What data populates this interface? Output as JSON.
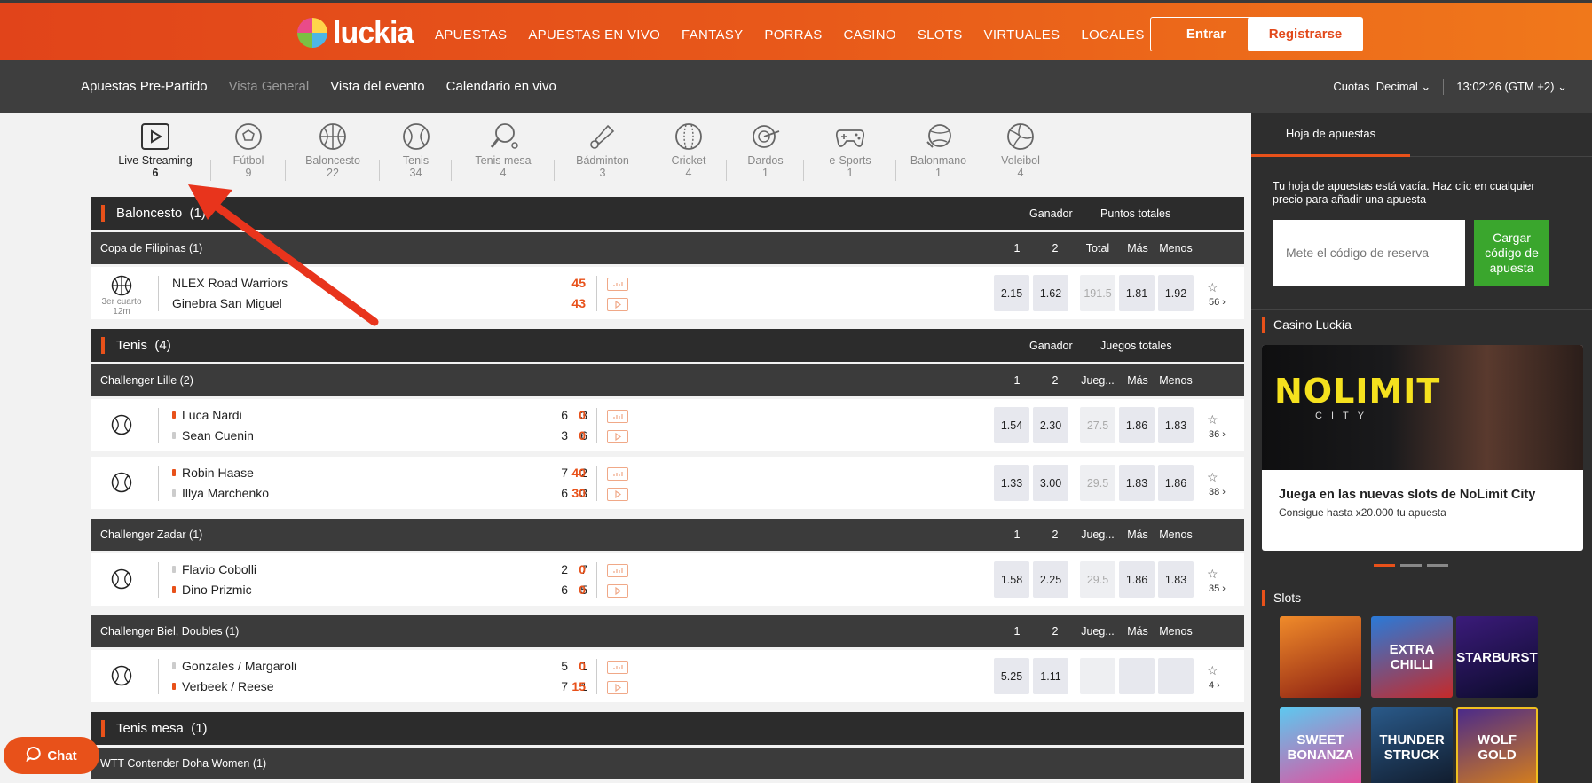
{
  "header": {
    "logo_text": "luckia",
    "nav": [
      "APUESTAS",
      "APUESTAS EN VIVO",
      "FANTASY",
      "PORRAS",
      "CASINO",
      "SLOTS",
      "VIRTUALES",
      "LOCALES"
    ],
    "login_label": "Entrar",
    "register_label": "Registrarse"
  },
  "subnav": {
    "links": [
      "Apuestas Pre-Partido",
      "Vista General",
      "Vista del evento",
      "Calendario en vivo"
    ],
    "odds_label": "Cuotas",
    "odds_value": "Decimal",
    "clock": "13:02:26",
    "timezone": "(GTM +2)"
  },
  "sports": [
    {
      "name": "Live Streaming",
      "count": "6",
      "icon": "play-icon"
    },
    {
      "name": "Fútbol",
      "count": "9",
      "icon": "soccer-icon"
    },
    {
      "name": "Baloncesto",
      "count": "22",
      "icon": "basketball-icon"
    },
    {
      "name": "Tenis",
      "count": "34",
      "icon": "tennis-icon"
    },
    {
      "name": "Tenis mesa",
      "count": "4",
      "icon": "table-tennis-icon"
    },
    {
      "name": "Bádminton",
      "count": "3",
      "icon": "badminton-icon"
    },
    {
      "name": "Cricket",
      "count": "4",
      "icon": "cricket-icon"
    },
    {
      "name": "Dardos",
      "count": "1",
      "icon": "darts-icon"
    },
    {
      "name": "e-Sports",
      "count": "1",
      "icon": "gamepad-icon"
    },
    {
      "name": "Balonmano",
      "count": "1",
      "icon": "handball-icon"
    },
    {
      "name": "Voleibol",
      "count": "4",
      "icon": "volleyball-icon"
    }
  ],
  "basket": {
    "title": "Baloncesto",
    "count": "(1)",
    "market1": "Ganador",
    "market2": "Puntos totales",
    "comp": "Copa de Filipinas (1)",
    "cols": [
      "1",
      "2",
      "Total",
      "Más",
      "Menos"
    ],
    "event": {
      "home": "NLEX Road Warriors",
      "away": "Ginebra San Miguel",
      "home_score": "45",
      "away_score": "43",
      "period": "3er cuarto",
      "minute": "12m",
      "odds": [
        "2.15",
        "1.62",
        "191.5",
        "1.81",
        "1.92"
      ],
      "markets": "56"
    }
  },
  "tennis": {
    "title": "Tenis",
    "count": "(4)",
    "market1": "Ganador",
    "market2": "Juegos totales",
    "cols": [
      "1",
      "2",
      "Jueg...",
      "Más",
      "Menos"
    ],
    "comps": [
      {
        "name": "Challenger Lille (2)",
        "events": [
          {
            "p1": "Luca Nardi",
            "p2": "Sean Cuenin",
            "s1": [
              "6",
              "3",
              "0"
            ],
            "s2": [
              "3",
              "6",
              "0"
            ],
            "serve": 1,
            "odds": [
              "1.54",
              "2.30",
              "27.5",
              "1.86",
              "1.83"
            ],
            "markets": "36"
          },
          {
            "p1": "Robin Haase",
            "p2": "Illya Marchenko",
            "s1": [
              "7",
              "2",
              "40"
            ],
            "s2": [
              "6",
              "3",
              "30"
            ],
            "serve": 1,
            "odds": [
              "1.33",
              "3.00",
              "29.5",
              "1.83",
              "1.86"
            ],
            "markets": "38"
          }
        ]
      },
      {
        "name": "Challenger Zadar (1)",
        "events": [
          {
            "p1": "Flavio Cobolli",
            "p2": "Dino Prizmic",
            "s1": [
              "2",
              "7",
              "0"
            ],
            "s2": [
              "6",
              "5",
              "0"
            ],
            "serve": 2,
            "odds": [
              "1.58",
              "2.25",
              "29.5",
              "1.86",
              "1.83"
            ],
            "markets": "35"
          }
        ]
      },
      {
        "name": "Challenger Biel, Doubles (1)",
        "events": [
          {
            "p1": "Gonzales / Margaroli",
            "p2": "Verbeek / Reese",
            "s1": [
              "5",
              "1",
              "0"
            ],
            "s2": [
              "7",
              "1",
              "15"
            ],
            "serve": 2,
            "odds": [
              "5.25",
              "1.11",
              "",
              "",
              ""
            ],
            "markets": "4"
          }
        ]
      }
    ]
  },
  "table_tennis": {
    "title": "Tenis mesa",
    "count": "(1)",
    "comp": "WTT Contender Doha Women (1)"
  },
  "betslip": {
    "tab": "Hoja de apuestas",
    "empty_message": "Tu hoja de apuestas está vacía. Haz clic en cualquier precio para añadir una apuesta",
    "code_placeholder": "Mete el código de reserva",
    "code_button": "Cargar código de apuesta"
  },
  "casino": {
    "title": "Casino Luckia",
    "banner_logo": "NOLIMIT",
    "banner_logo_sub": "CITY",
    "banner_title": "Juega en las nuevas slots de NoLimit City",
    "banner_sub": "Consigue hasta x20.000 tu apuesta"
  },
  "slots": {
    "title": "Slots",
    "games": [
      "",
      "EXTRA CHILLI",
      "STARBURST",
      "SWEET BONANZA",
      "THUNDER STRUCK",
      "WOLF GOLD"
    ]
  },
  "chat_label": "Chat",
  "colors": {
    "brand": "#e8511a",
    "dark": "#2c2c2c",
    "green": "#3aa62d"
  }
}
